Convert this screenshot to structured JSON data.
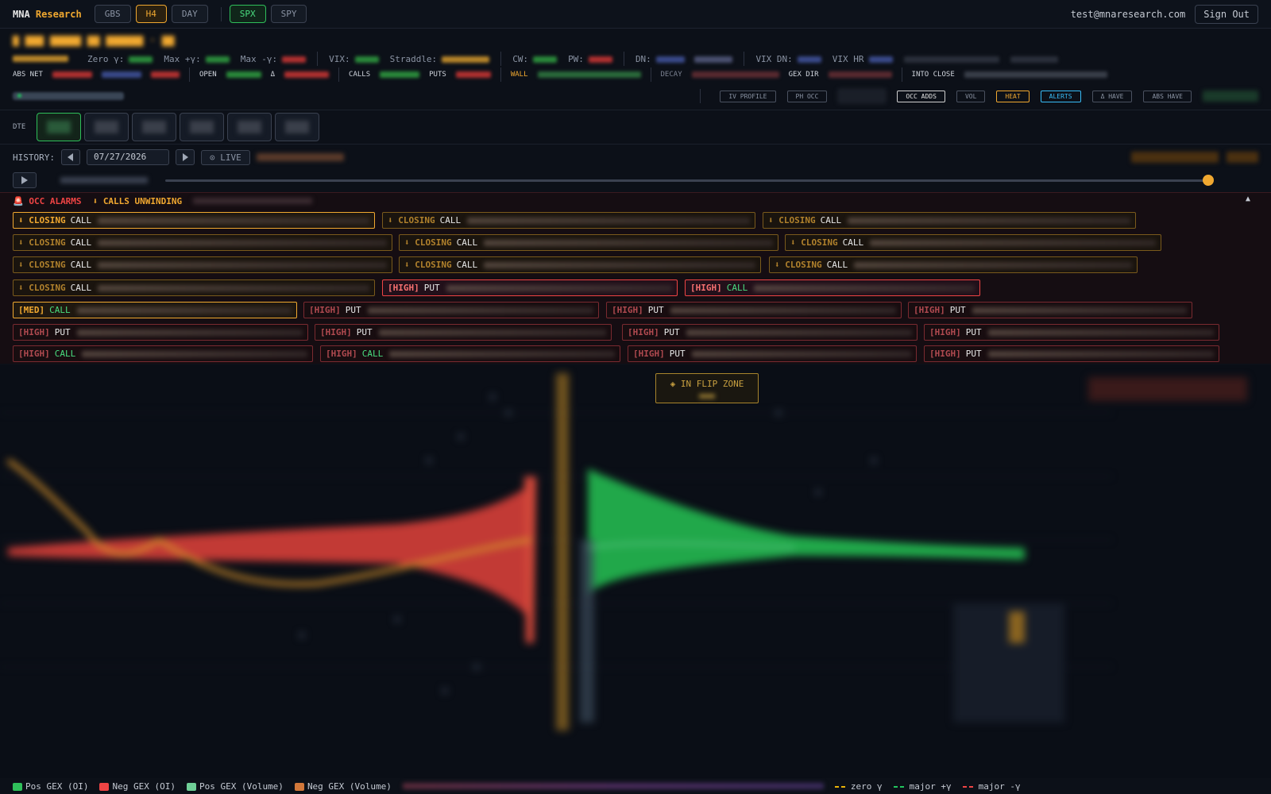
{
  "topbar": {
    "logo_prefix": "MNA",
    "logo_brand": "Research",
    "views": [
      "GBS",
      "H4",
      "DAY"
    ],
    "active_view": "H4",
    "tickers": [
      "SPX",
      "SPY"
    ],
    "active_ticker": "SPX",
    "email": "test@mnaresearch.com",
    "signout": "Sign Out"
  },
  "stats": {
    "zero_gamma": "Zero γ:",
    "max_pos_gamma": "Max +γ:",
    "max_neg_gamma": "Max -γ:",
    "vix": "VIX:",
    "straddle": "Straddle:",
    "cw": "CW:",
    "pw": "PW:",
    "dn": "DN:",
    "vix_dn": "VIX DN:",
    "vix_hr": "VIX HR"
  },
  "row2": {
    "abs_net": "ABS NET",
    "open": "OPEN",
    "delta": "Δ",
    "calls": "CALLS",
    "puts": "PUTS",
    "wall": "WALL",
    "decay": "DECAY",
    "gex_dir": "GEX DIR",
    "into_close": "INTO CLOSE"
  },
  "controls": [
    "IV PROFILE",
    "PH OCC",
    "OCC ADDS",
    "VOL",
    "HEAT",
    "ALERTS",
    "Δ HAVE",
    "ABS HAVE"
  ],
  "dte_label": "DTE",
  "history": {
    "label": "HISTORY:",
    "date": "07/27/2026",
    "live": "LIVE"
  },
  "alarms": {
    "title": "OCC ALARMS",
    "subtitle": "CALLS UNWINDING",
    "chips": [
      {
        "tag": "⬇ CLOSING",
        "kind": "CALL"
      },
      {
        "tag": "⬇ CLOSING",
        "kind": "CALL"
      },
      {
        "tag": "⬇ CLOSING",
        "kind": "CALL"
      },
      {
        "tag": "⬇ CLOSING",
        "kind": "CALL"
      },
      {
        "tag": "⬇ CLOSING",
        "kind": "CALL"
      },
      {
        "tag": "⬇ CLOSING",
        "kind": "CALL"
      },
      {
        "tag": "⬇ CLOSING",
        "kind": "CALL"
      },
      {
        "tag": "⬇ CLOSING",
        "kind": "CALL"
      },
      {
        "tag": "⬇ CLOSING",
        "kind": "CALL"
      },
      {
        "tag": "⬇ CLOSING",
        "kind": "CALL"
      },
      {
        "tag": "[HIGH]",
        "kind": "PUT"
      },
      {
        "tag": "[HIGH]",
        "kind": "CALL"
      },
      {
        "tag": "[MED]",
        "kind": "CALL"
      },
      {
        "tag": "[HIGH]",
        "kind": "PUT"
      },
      {
        "tag": "[HIGH]",
        "kind": "PUT"
      },
      {
        "tag": "[HIGH]",
        "kind": "PUT"
      },
      {
        "tag": "[HIGH]",
        "kind": "PUT"
      },
      {
        "tag": "[HIGH]",
        "kind": "PUT"
      },
      {
        "tag": "[HIGH]",
        "kind": "PUT"
      },
      {
        "tag": "[HIGH]",
        "kind": "PUT"
      },
      {
        "tag": "[HIGH]",
        "kind": "CALL"
      },
      {
        "tag": "[HIGH]",
        "kind": "CALL"
      },
      {
        "tag": "[HIGH]",
        "kind": "PUT"
      },
      {
        "tag": "[HIGH]",
        "kind": "PUT"
      }
    ]
  },
  "flip_zone": "◈ IN FLIP ZONE",
  "legend": {
    "pos_oi": "Pos GEX (OI)",
    "neg_oi": "Neg GEX (OI)",
    "pos_vol": "Pos GEX (Volume)",
    "neg_vol": "Neg GEX (Volume)",
    "zero": "zero γ",
    "major_pos": "major +γ",
    "major_neg": "major -γ"
  },
  "colors": {
    "accent": "#f0a830",
    "pos": "#2fbf5a",
    "neg": "#ef4444",
    "pos_vol": "#6fcf97",
    "neg_vol": "#d2783a"
  }
}
